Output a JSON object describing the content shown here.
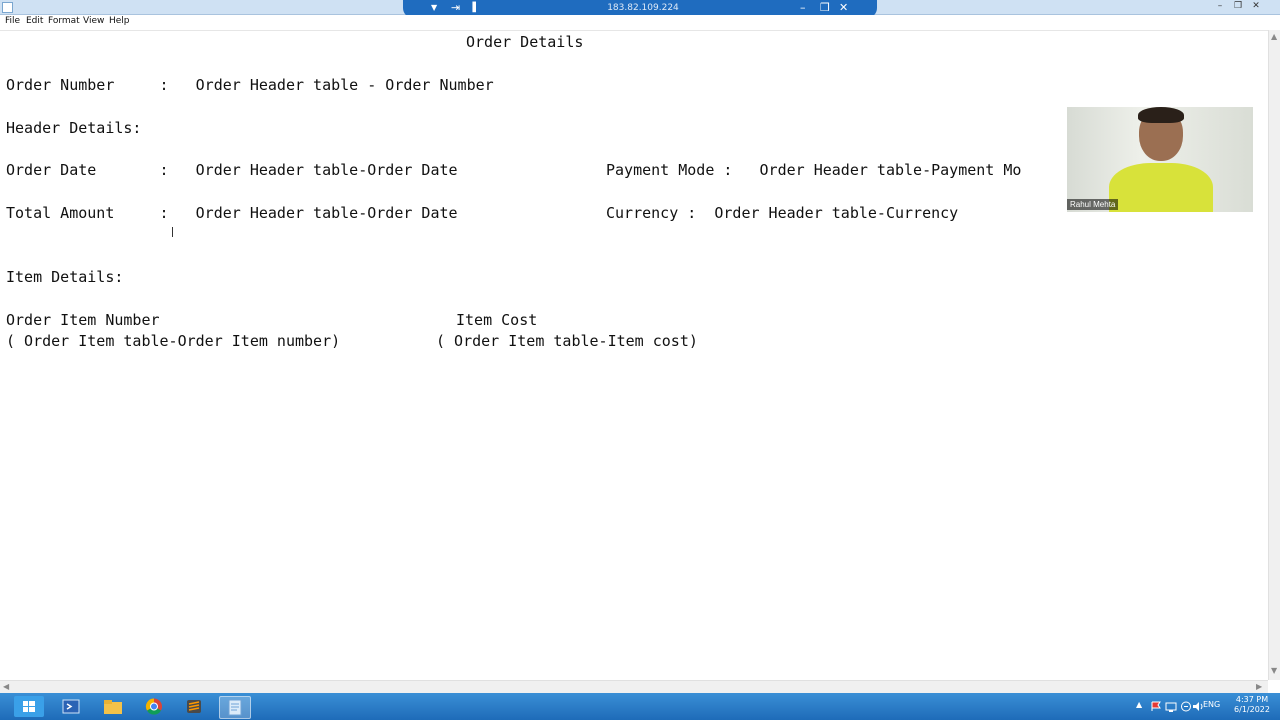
{
  "remote_bar": {
    "ip": "183.82.109.224",
    "pin_glyph": "▼",
    "pushpin_glyph": "⇥",
    "signal_glyph": "▐",
    "min_glyph": "–",
    "restore_glyph": "❒",
    "close_glyph": "✕"
  },
  "window_controls": {
    "min": "–",
    "restore": "❒",
    "close": "✕"
  },
  "menu": [
    "File",
    "Edit",
    "Format",
    "View",
    "Help"
  ],
  "doc": {
    "title": "Order Details",
    "order_number_line": "Order Number     :   Order Header table - Order Number",
    "header_details_heading": "Header Details:",
    "order_date_line": "Order Date       :   Order Header table-Order Date",
    "payment_mode_line": "Payment Mode :   Order Header table-Payment Mo",
    "total_amount_line": "Total Amount     :   Order Header table-Order Date",
    "currency_line": "Currency :  Order Header table-Currency",
    "item_details_heading": "Item Details:",
    "order_item_number_label": "Order Item Number",
    "item_cost_label": "Item Cost",
    "order_item_number_value": "( Order Item table-Order Item number)",
    "item_cost_value": "( Order Item table-Item cost)"
  },
  "webcam": {
    "name": "Rahul Mehta"
  },
  "taskbar": {
    "lang": "ENG",
    "time": "4:37 PM",
    "date": "6/1/2022",
    "tray_up_glyph": "▲"
  },
  "colors": {
    "taskbar": "#1e6bb8",
    "remote_bar": "#1f6cbf",
    "webcam_shirt": "#d8e23a"
  }
}
